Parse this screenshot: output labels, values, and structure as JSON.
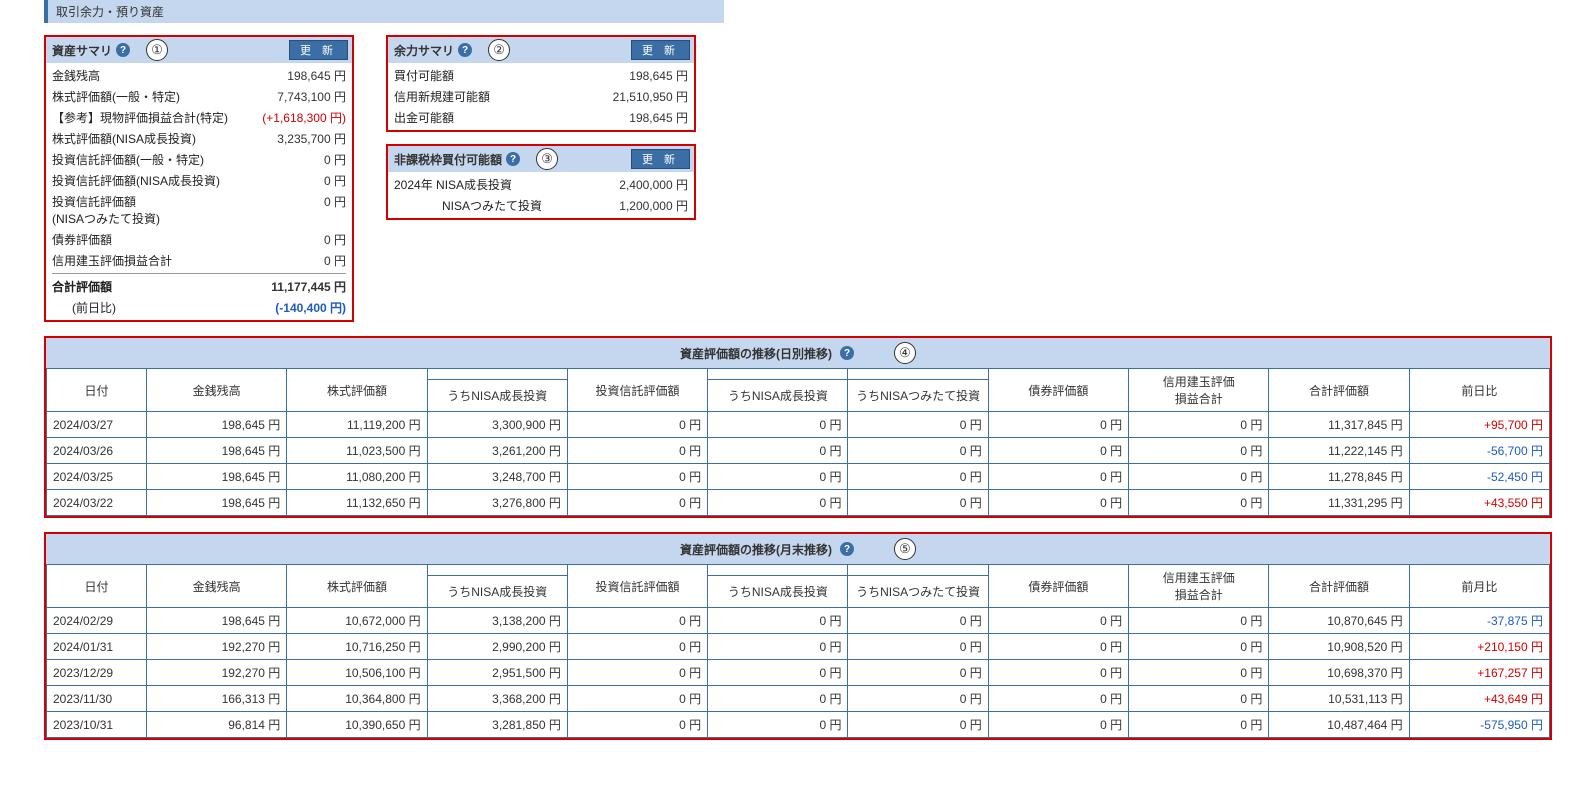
{
  "page_title": "取引余力・預り資産",
  "update_label": "更 新",
  "panel1": {
    "title": "資産サマリ",
    "badge": "①",
    "rows": [
      {
        "label": "金銭残高",
        "value": "198,645 円"
      },
      {
        "label": "株式評価額(一般・特定)",
        "value": "7,743,100 円"
      },
      {
        "label": "【参考】現物評価損益合計(特定)",
        "value": "(+1,618,300 円)",
        "cls": "red"
      },
      {
        "label": "株式評価額(NISA成長投資)",
        "value": "3,235,700 円"
      },
      {
        "label": "投資信託評価額(一般・特定)",
        "value": "0 円"
      },
      {
        "label": "投資信託評価額(NISA成長投資)",
        "value": "0 円"
      },
      {
        "label": "投資信託評価額\n(NISAつみたて投資)",
        "value": "0 円"
      },
      {
        "label": "債券評価額",
        "value": "0 円"
      },
      {
        "label": "信用建玉評価損益合計",
        "value": "0 円"
      }
    ],
    "total_label": "合計評価額",
    "total_value": "11,177,445 円",
    "prev_label": "(前日比)",
    "prev_value": "(-140,400 円)"
  },
  "panel2": {
    "title": "余力サマリ",
    "badge": "②",
    "rows": [
      {
        "label": "買付可能額",
        "value": "198,645 円"
      },
      {
        "label": "信用新規建可能額",
        "value": "21,510,950 円"
      },
      {
        "label": "出金可能額",
        "value": "198,645 円"
      }
    ]
  },
  "panel3": {
    "title": "非課税枠買付可能額",
    "badge": "③",
    "rows": [
      {
        "label": "2024年  NISA成長投資",
        "value": "2,400,000 円"
      },
      {
        "label": "NISAつみたて投資",
        "value": "1,200,000 円",
        "indent": true
      }
    ]
  },
  "daily": {
    "title": "資産評価額の推移(日別推移)",
    "badge": "④",
    "headers": [
      "日付",
      "金銭残高",
      "株式評価額",
      "うちNISA成長投資",
      "投資信託評価額",
      "うちNISA成長投資",
      "うちNISAつみたて投資",
      "債券評価額",
      "信用建玉評価\n損益合計",
      "合計評価額",
      "前日比"
    ],
    "rows": [
      [
        "2024/03/27",
        "198,645 円",
        "11,119,200 円",
        "3,300,900 円",
        "0 円",
        "0 円",
        "0 円",
        "0 円",
        "0 円",
        "11,317,845 円",
        {
          "v": "+95,700 円",
          "c": "red"
        }
      ],
      [
        "2024/03/26",
        "198,645 円",
        "11,023,500 円",
        "3,261,200 円",
        "0 円",
        "0 円",
        "0 円",
        "0 円",
        "0 円",
        "11,222,145 円",
        {
          "v": "-56,700 円",
          "c": "blue"
        }
      ],
      [
        "2024/03/25",
        "198,645 円",
        "11,080,200 円",
        "3,248,700 円",
        "0 円",
        "0 円",
        "0 円",
        "0 円",
        "0 円",
        "11,278,845 円",
        {
          "v": "-52,450 円",
          "c": "blue"
        }
      ],
      [
        "2024/03/22",
        "198,645 円",
        "11,132,650 円",
        "3,276,800 円",
        "0 円",
        "0 円",
        "0 円",
        "0 円",
        "0 円",
        "11,331,295 円",
        {
          "v": "+43,550 円",
          "c": "red"
        }
      ]
    ]
  },
  "monthly": {
    "title": "資産評価額の推移(月末推移)",
    "badge": "⑤",
    "headers": [
      "日付",
      "金銭残高",
      "株式評価額",
      "うちNISA成長投資",
      "投資信託評価額",
      "うちNISA成長投資",
      "うちNISAつみたて投資",
      "債券評価額",
      "信用建玉評価\n損益合計",
      "合計評価額",
      "前月比"
    ],
    "rows": [
      [
        "2024/02/29",
        "198,645 円",
        "10,672,000 円",
        "3,138,200 円",
        "0 円",
        "0 円",
        "0 円",
        "0 円",
        "0 円",
        "10,870,645 円",
        {
          "v": "-37,875 円",
          "c": "blue"
        }
      ],
      [
        "2024/01/31",
        "192,270 円",
        "10,716,250 円",
        "2,990,200 円",
        "0 円",
        "0 円",
        "0 円",
        "0 円",
        "0 円",
        "10,908,520 円",
        {
          "v": "+210,150 円",
          "c": "red"
        }
      ],
      [
        "2023/12/29",
        "192,270 円",
        "10,506,100 円",
        "2,951,500 円",
        "0 円",
        "0 円",
        "0 円",
        "0 円",
        "0 円",
        "10,698,370 円",
        {
          "v": "+167,257 円",
          "c": "red"
        }
      ],
      [
        "2023/11/30",
        "166,313 円",
        "10,364,800 円",
        "3,368,200 円",
        "0 円",
        "0 円",
        "0 円",
        "0 円",
        "0 円",
        "10,531,113 円",
        {
          "v": "+43,649 円",
          "c": "red"
        }
      ],
      [
        "2023/10/31",
        "96,814 円",
        "10,390,650 円",
        "3,281,850 円",
        "0 円",
        "0 円",
        "0 円",
        "0 円",
        "0 円",
        "10,487,464 円",
        {
          "v": "-575,950 円",
          "c": "blue"
        }
      ]
    ]
  }
}
